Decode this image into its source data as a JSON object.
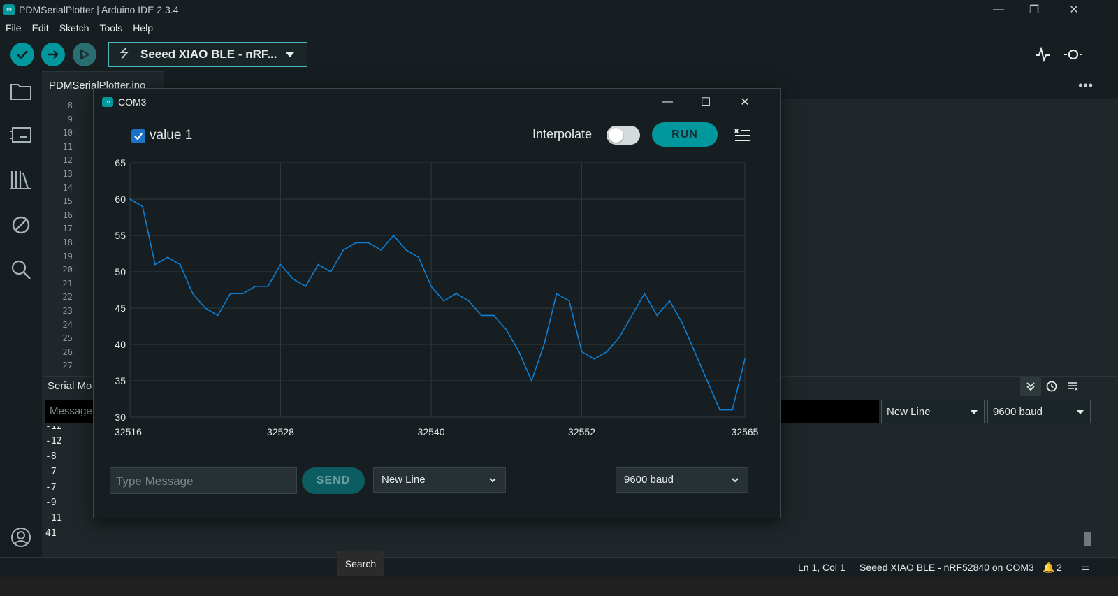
{
  "window": {
    "title": "PDMSerialPlotter | Arduino IDE 2.3.4"
  },
  "menu": [
    "File",
    "Edit",
    "Sketch",
    "Tools",
    "Help"
  ],
  "toolbar": {
    "board_label": "Seeed XIAO BLE - nRF..."
  },
  "editor": {
    "tab_label": "PDMSerialPlotter.ino",
    "line_numbers": [
      "8",
      "9",
      "10",
      "11",
      "12",
      "13",
      "14",
      "15",
      "16",
      "17",
      "18",
      "19",
      "20",
      "21",
      "22",
      "23",
      "24",
      "25",
      "26",
      "27"
    ]
  },
  "serial_monitor": {
    "title": "Serial Mo",
    "message_placeholder": "Message",
    "line_ending": "New Line",
    "baud": "9600 baud",
    "output_lines": [
      "-12",
      "-12",
      "-8",
      "-7",
      "-7",
      "-9",
      "-11",
      "41"
    ]
  },
  "status_bar": {
    "cursor": "Ln 1, Col 1",
    "board": "Seeed XIAO BLE - nRF52840 on COM3",
    "notifications": "2"
  },
  "tooltip": "Search",
  "plotter": {
    "title": "COM3",
    "legend_label": "value 1",
    "legend_checked": true,
    "interpolate_label": "Interpolate",
    "run_label": "RUN",
    "message_placeholder": "Type Message",
    "send_label": "SEND",
    "line_ending": "New Line",
    "baud": "9600 baud"
  },
  "chart_data": {
    "type": "line",
    "series": [
      {
        "name": "value 1",
        "color": "#0e7fd4",
        "x": [
          32516,
          32517,
          32518,
          32519,
          32520,
          32521,
          32522,
          32523,
          32524,
          32525,
          32526,
          32527,
          32528,
          32529,
          32530,
          32531,
          32532,
          32533,
          32534,
          32535,
          32536,
          32537,
          32538,
          32539,
          32540,
          32541,
          32542,
          32543,
          32544,
          32545,
          32546,
          32547,
          32548,
          32549,
          32550,
          32551,
          32552,
          32553,
          32554,
          32555,
          32556,
          32557,
          32558,
          32559,
          32560,
          32561,
          32562,
          32563,
          32564,
          32565
        ],
        "values": [
          60,
          59,
          51,
          52,
          51,
          47,
          45,
          44,
          47,
          47,
          48,
          48,
          51,
          49,
          48,
          51,
          50,
          53,
          54,
          54,
          53,
          55,
          53,
          52,
          48,
          46,
          47,
          46,
          44,
          44,
          42,
          39,
          35,
          40,
          47,
          46,
          39,
          38,
          39,
          41,
          44,
          47,
          44,
          46,
          43,
          39,
          35,
          31,
          31,
          38
        ]
      }
    ],
    "x_ticks": [
      "32516",
      "32528",
      "32540",
      "32552",
      "32565"
    ],
    "y_ticks": [
      "65",
      "60",
      "55",
      "50",
      "45",
      "40",
      "35",
      "30"
    ],
    "xlim": [
      32516,
      32565
    ],
    "ylim": [
      30,
      65
    ],
    "grid": true
  }
}
